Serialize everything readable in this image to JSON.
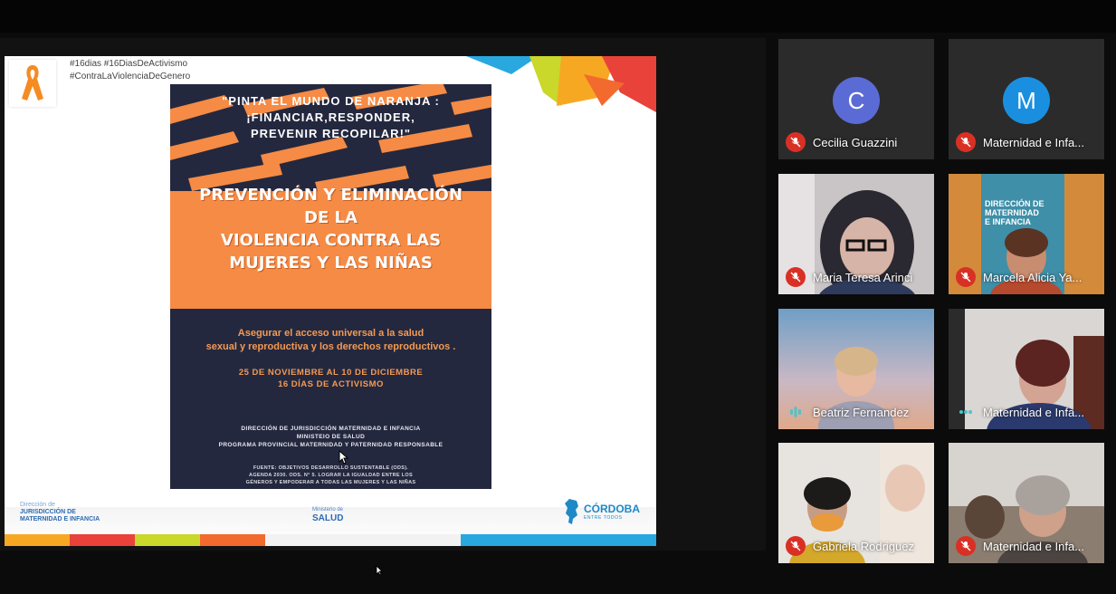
{
  "slide": {
    "hashtags": [
      "#16dias  #16DiasDeActivismo",
      "#ContraLaViolenciaDeGenero"
    ],
    "poster": {
      "quote": [
        "\"PINTA EL MUNDO DE NARANJA :",
        "¡FINANCIAR,RESPONDER,",
        "PREVENIR RECOPILAR!\""
      ],
      "headline": [
        "PREVENCIÓN Y ELIMINACIÓN",
        "DE LA",
        "VIOLENCIA CONTRA LAS",
        "MUJERES Y LAS NIÑAS"
      ],
      "access": [
        "Asegurar el acceso universal a la salud",
        "sexual y reproductiva y los derechos reproductivos ."
      ],
      "dates": [
        "25 DE NOVIEMBRE AL 10 DE DICIEMBRE",
        "16 DÍAS DE ACTIVISMO"
      ],
      "org": [
        "DIRECCIÓN DE JURISDICCIÓN MATERNIDAD E INFANCIA",
        "MINISTEIO DE SALUD",
        "PROGRAMA PROVINCIAL MATERNIDAD Y PATERNIDAD RESPONSABLE"
      ],
      "source": [
        "FUENTE: OBJETIVOS DESARROLLO SUSTENTABLE (ODS).",
        "AGENDA 2030. ODS. N° 5. LOGRAR LA IGUALDAD ENTRE LOS",
        "GÉNEROS Y EMPODERAR A TODAS LAS MUJERES Y LAS NIÑAS"
      ]
    },
    "footer": {
      "logo1_small": "Dirección de",
      "logo1_lines": [
        "JURISDICCIÓN DE",
        "MATERNIDAD E INFANCIA"
      ],
      "logo2_small": "Ministerio de",
      "logo2_big": "SALUD",
      "logo3_main": "CÓRDOBA",
      "logo3_sub": "ENTRE TODOS"
    }
  },
  "participants": [
    {
      "name": "Cecilia Guazzini",
      "initial": "C",
      "avatar_color": "#5b6bd5",
      "mic": "muted",
      "video": false
    },
    {
      "name": "Maternidad e Infa...",
      "initial": "M",
      "avatar_color": "#1a8fe0",
      "mic": "muted",
      "video": false
    },
    {
      "name": "Maria Teresa Arinci",
      "mic": "muted",
      "video": true
    },
    {
      "name": "Marcela Alicia Ya...",
      "mic": "muted",
      "video": true,
      "banner_text": [
        "DIRECCIÓN DE",
        "MATERNIDAD",
        "E INFANCIA"
      ]
    },
    {
      "name": "Beatriz Fernandez",
      "mic": "speaking",
      "video": true
    },
    {
      "name": "Maternidad e Infa...",
      "mic": "active",
      "video": true
    },
    {
      "name": "Gabriela Rodriguez",
      "mic": "muted",
      "video": true
    },
    {
      "name": "Maternidad e Infa...",
      "mic": "muted",
      "video": true
    }
  ],
  "colors": {
    "accent_orange": "#f58b45",
    "poster_navy": "#24283f",
    "mic_off": "#d93025",
    "speaking": "#4fc3c7"
  }
}
